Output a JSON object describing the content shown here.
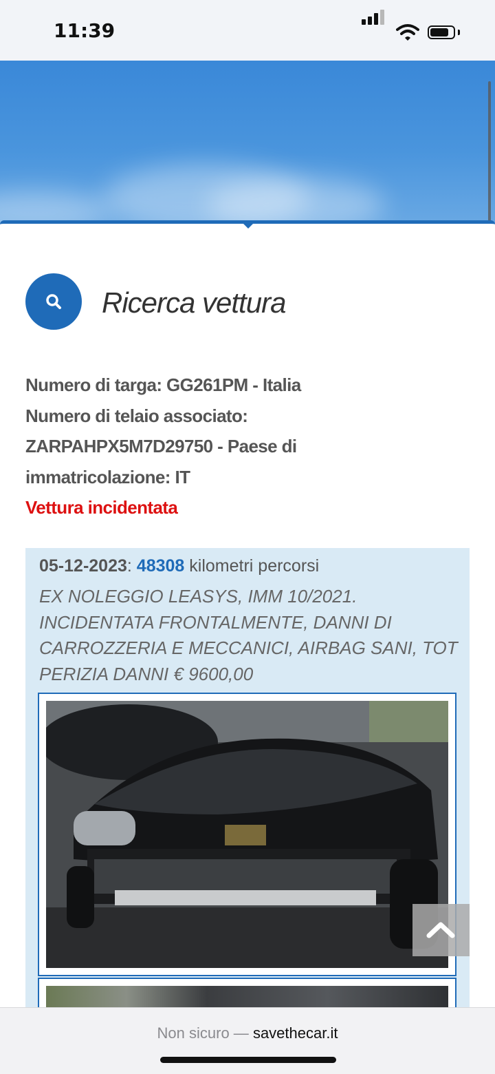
{
  "status_bar": {
    "time": "11:39"
  },
  "page": {
    "title": "Ricerca vettura"
  },
  "vehicle": {
    "plate_line": "Numero di targa: GG261PM - Italia",
    "vin_label": "Numero di telaio associato:",
    "vin_line": "ZARPAHPX5M7D29750 - Paese di",
    "country_line": "immatricolazione: IT",
    "alert": "Vettura incidentata"
  },
  "record": {
    "date": "05-12-2023",
    "separator": ":",
    "km": "48308",
    "km_suffix": "kilometri percorsi",
    "note": "EX NOLEGGIO LEASYS, IMM 10/2021. INCIDENTATA FRONTALMENTE, DANNI DI CARROZZERIA E MECCANICI, AIRBAG SANI, TOT PERIZIA DANNI € 9600,00"
  },
  "browser": {
    "security": "Non sicuro —",
    "host": "savethecar.it"
  },
  "colors": {
    "accent": "#1f6bb8",
    "alert": "#dd1111",
    "record_bg": "#d9eaf5"
  },
  "icons": [
    "search-icon",
    "chevron-up-icon",
    "signal-icon",
    "wifi-icon",
    "battery-icon"
  ]
}
